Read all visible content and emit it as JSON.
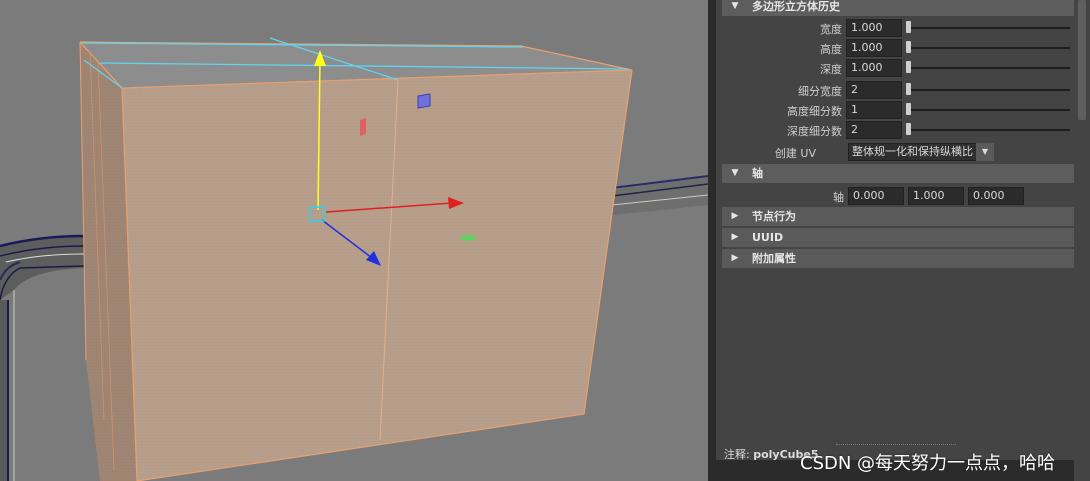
{
  "history": {
    "title": "多边形立方体历史",
    "rows": [
      {
        "label": "宽度",
        "value": "1.000",
        "slider": 0.0
      },
      {
        "label": "高度",
        "value": "1.000",
        "slider": 0.0
      },
      {
        "label": "深度",
        "value": "1.000",
        "slider": 0.0
      },
      {
        "label": "细分宽度",
        "value": "2",
        "slider": 0.0
      },
      {
        "label": "高度细分数",
        "value": "1",
        "slider": 0.0
      },
      {
        "label": "深度细分数",
        "value": "2",
        "slider": 0.0
      }
    ],
    "uv_label": "创建 UV",
    "uv_value": "整体规一化和保持纵横比"
  },
  "axis": {
    "title": "轴",
    "label": "轴",
    "x": "0.000",
    "y": "1.000",
    "z": "0.000"
  },
  "collapsed_sections": [
    {
      "title": "节点行为"
    },
    {
      "title": "UUID"
    },
    {
      "title": "附加属性"
    }
  ],
  "notes": {
    "label": "注释:",
    "node": "polyCube5"
  },
  "watermark": "CSDN @每天努力一点点，哈哈",
  "colors": {
    "cube_face": "#b09d8e",
    "cube_top": "#888888",
    "wire_orange": "#e8a070",
    "selected_edge": "#5fd4f0",
    "axis_x": "#e02020",
    "axis_y": "#ffff20",
    "axis_z": "#2030e0",
    "panel_bg": "#444444",
    "header_bg": "#5d5d5d"
  }
}
